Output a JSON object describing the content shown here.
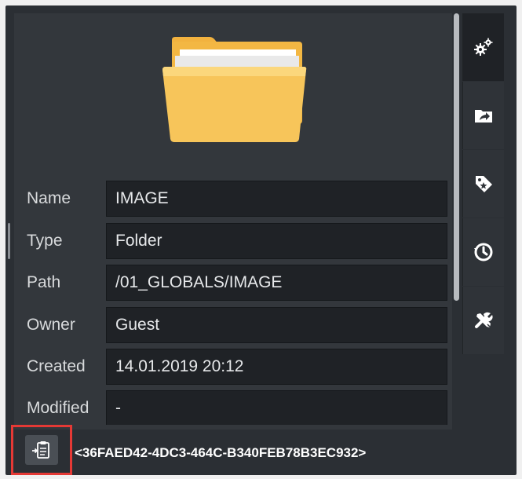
{
  "properties": [
    {
      "label": "Name",
      "value": "IMAGE"
    },
    {
      "label": "Type",
      "value": "Folder"
    },
    {
      "label": "Path",
      "value": "/01_GLOBALS/IMAGE"
    },
    {
      "label": "Owner",
      "value": "Guest"
    },
    {
      "label": "Created",
      "value": "14.01.2019 20:12"
    },
    {
      "label": "Modified",
      "value": "-"
    }
  ],
  "side_tabs": [
    {
      "icon": "gears-icon",
      "active": true
    },
    {
      "icon": "folder-arrow-icon",
      "active": false
    },
    {
      "icon": "tag-icon",
      "active": false
    },
    {
      "icon": "history-icon",
      "active": false
    },
    {
      "icon": "tools-icon",
      "active": false
    }
  ],
  "footer": {
    "button_icon": "insert-clipboard-icon",
    "guid": "<36FAED42-4DC3-464C-B340FEB78B3EC932>"
  },
  "colors": {
    "background": "#2b2f34",
    "panel": "#33373c",
    "field": "#1f2226",
    "highlight_border": "#e53935",
    "folder": "#f7c55a"
  }
}
